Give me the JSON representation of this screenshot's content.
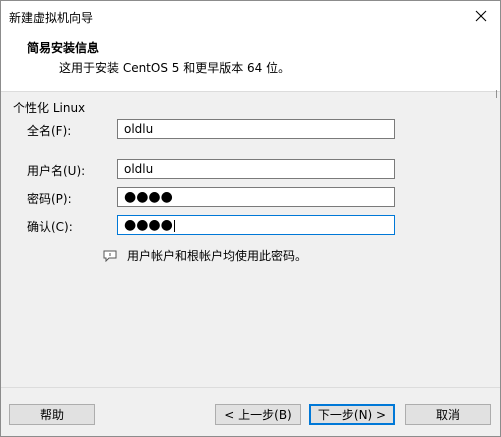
{
  "window": {
    "title": "新建虚拟机向导"
  },
  "header": {
    "title": "简易安装信息",
    "subtitle": "这用于安装 CentOS 5 和更早版本 64 位。"
  },
  "group": {
    "label": "个性化 Linux"
  },
  "fields": {
    "fullname": {
      "label": "全名(F):",
      "value": "oldlu"
    },
    "username": {
      "label": "用户名(U):",
      "value": "oldlu"
    },
    "password": {
      "label": "密码(P):",
      "value": "●●●●"
    },
    "confirm": {
      "label": "确认(C):",
      "value": "●●●●"
    }
  },
  "info": {
    "text": "用户帐户和根帐户均使用此密码。",
    "icon": "info-message-icon"
  },
  "buttons": {
    "help": "帮助",
    "back": "< 上一步(B)",
    "next": "下一步(N) >",
    "cancel": "取消"
  },
  "colors": {
    "accent": "#0078d7",
    "dialog_bg": "#f0f0f0"
  }
}
